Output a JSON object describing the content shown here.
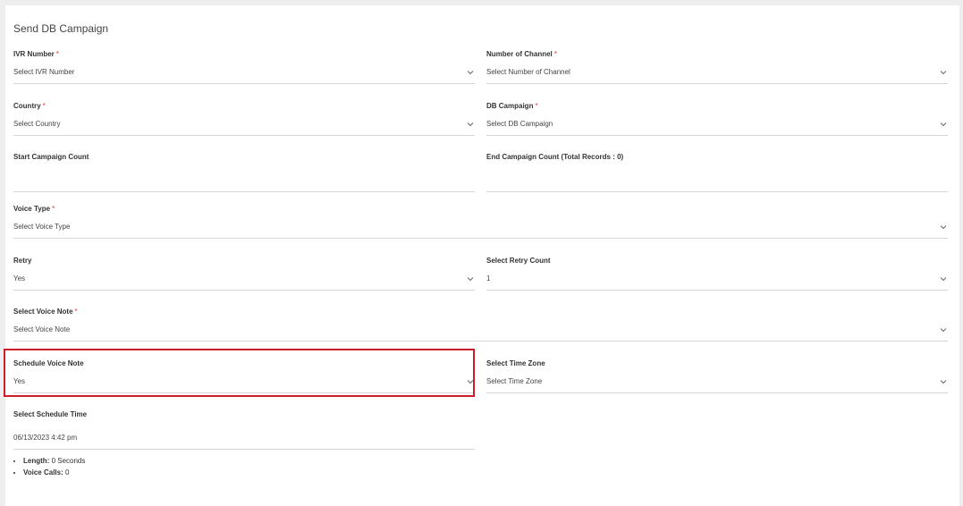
{
  "page": {
    "title": "Send DB Campaign"
  },
  "fields": {
    "ivr_number": {
      "label": "IVR Number",
      "value": "Select IVR Number",
      "required": "*"
    },
    "channels": {
      "label": "Number of Channel",
      "value": "Select Number of Channel",
      "required": "*"
    },
    "country": {
      "label": "Country",
      "value": "Select Country",
      "required": "*"
    },
    "db_campaign": {
      "label": "DB Campaign",
      "value": "Select DB Campaign",
      "required": "*"
    },
    "start_count": {
      "label": "Start Campaign Count",
      "value": ""
    },
    "end_count": {
      "label": "End Campaign Count (Total Records : 0)",
      "value": ""
    },
    "voice_type": {
      "label": "Voice Type",
      "value": "Select Voice Type",
      "required": "*"
    },
    "retry": {
      "label": "Retry",
      "value": "Yes"
    },
    "retry_count": {
      "label": "Select Retry Count",
      "value": "1"
    },
    "voice_note": {
      "label": "Select Voice Note",
      "value": "Select Voice Note",
      "required": "*"
    },
    "schedule_voice_note": {
      "label": "Schedule Voice Note",
      "value": "Yes"
    },
    "time_zone": {
      "label": "Select Time Zone",
      "value": "Select Time Zone"
    },
    "schedule_time": {
      "label": "Select Schedule Time",
      "value": "06/13/2023 4:42 pm"
    }
  },
  "stats": {
    "length_label": "Length:",
    "length_value": "0 Seconds",
    "calls_label": "Voice Calls:",
    "calls_value": "0"
  },
  "colors": {
    "highlight": "#cc1f2b",
    "required": "#e53935"
  }
}
